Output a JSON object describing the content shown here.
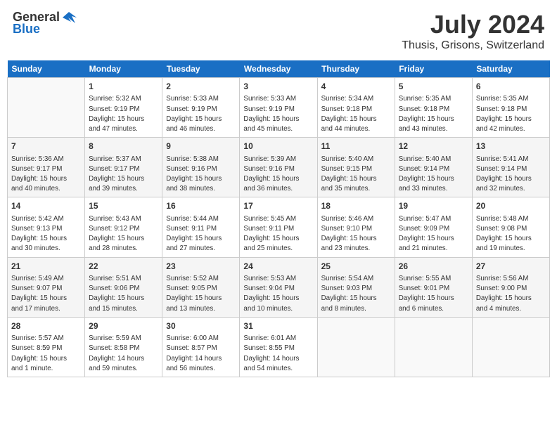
{
  "header": {
    "logo_general": "General",
    "logo_blue": "Blue",
    "month_year": "July 2024",
    "location": "Thusis, Grisons, Switzerland"
  },
  "columns": [
    "Sunday",
    "Monday",
    "Tuesday",
    "Wednesday",
    "Thursday",
    "Friday",
    "Saturday"
  ],
  "weeks": [
    [
      {
        "day": "",
        "content": ""
      },
      {
        "day": "1",
        "content": "Sunrise: 5:32 AM\nSunset: 9:19 PM\nDaylight: 15 hours\nand 47 minutes."
      },
      {
        "day": "2",
        "content": "Sunrise: 5:33 AM\nSunset: 9:19 PM\nDaylight: 15 hours\nand 46 minutes."
      },
      {
        "day": "3",
        "content": "Sunrise: 5:33 AM\nSunset: 9:19 PM\nDaylight: 15 hours\nand 45 minutes."
      },
      {
        "day": "4",
        "content": "Sunrise: 5:34 AM\nSunset: 9:18 PM\nDaylight: 15 hours\nand 44 minutes."
      },
      {
        "day": "5",
        "content": "Sunrise: 5:35 AM\nSunset: 9:18 PM\nDaylight: 15 hours\nand 43 minutes."
      },
      {
        "day": "6",
        "content": "Sunrise: 5:35 AM\nSunset: 9:18 PM\nDaylight: 15 hours\nand 42 minutes."
      }
    ],
    [
      {
        "day": "7",
        "content": "Sunrise: 5:36 AM\nSunset: 9:17 PM\nDaylight: 15 hours\nand 40 minutes."
      },
      {
        "day": "8",
        "content": "Sunrise: 5:37 AM\nSunset: 9:17 PM\nDaylight: 15 hours\nand 39 minutes."
      },
      {
        "day": "9",
        "content": "Sunrise: 5:38 AM\nSunset: 9:16 PM\nDaylight: 15 hours\nand 38 minutes."
      },
      {
        "day": "10",
        "content": "Sunrise: 5:39 AM\nSunset: 9:16 PM\nDaylight: 15 hours\nand 36 minutes."
      },
      {
        "day": "11",
        "content": "Sunrise: 5:40 AM\nSunset: 9:15 PM\nDaylight: 15 hours\nand 35 minutes."
      },
      {
        "day": "12",
        "content": "Sunrise: 5:40 AM\nSunset: 9:14 PM\nDaylight: 15 hours\nand 33 minutes."
      },
      {
        "day": "13",
        "content": "Sunrise: 5:41 AM\nSunset: 9:14 PM\nDaylight: 15 hours\nand 32 minutes."
      }
    ],
    [
      {
        "day": "14",
        "content": "Sunrise: 5:42 AM\nSunset: 9:13 PM\nDaylight: 15 hours\nand 30 minutes."
      },
      {
        "day": "15",
        "content": "Sunrise: 5:43 AM\nSunset: 9:12 PM\nDaylight: 15 hours\nand 28 minutes."
      },
      {
        "day": "16",
        "content": "Sunrise: 5:44 AM\nSunset: 9:11 PM\nDaylight: 15 hours\nand 27 minutes."
      },
      {
        "day": "17",
        "content": "Sunrise: 5:45 AM\nSunset: 9:11 PM\nDaylight: 15 hours\nand 25 minutes."
      },
      {
        "day": "18",
        "content": "Sunrise: 5:46 AM\nSunset: 9:10 PM\nDaylight: 15 hours\nand 23 minutes."
      },
      {
        "day": "19",
        "content": "Sunrise: 5:47 AM\nSunset: 9:09 PM\nDaylight: 15 hours\nand 21 minutes."
      },
      {
        "day": "20",
        "content": "Sunrise: 5:48 AM\nSunset: 9:08 PM\nDaylight: 15 hours\nand 19 minutes."
      }
    ],
    [
      {
        "day": "21",
        "content": "Sunrise: 5:49 AM\nSunset: 9:07 PM\nDaylight: 15 hours\nand 17 minutes."
      },
      {
        "day": "22",
        "content": "Sunrise: 5:51 AM\nSunset: 9:06 PM\nDaylight: 15 hours\nand 15 minutes."
      },
      {
        "day": "23",
        "content": "Sunrise: 5:52 AM\nSunset: 9:05 PM\nDaylight: 15 hours\nand 13 minutes."
      },
      {
        "day": "24",
        "content": "Sunrise: 5:53 AM\nSunset: 9:04 PM\nDaylight: 15 hours\nand 10 minutes."
      },
      {
        "day": "25",
        "content": "Sunrise: 5:54 AM\nSunset: 9:03 PM\nDaylight: 15 hours\nand 8 minutes."
      },
      {
        "day": "26",
        "content": "Sunrise: 5:55 AM\nSunset: 9:01 PM\nDaylight: 15 hours\nand 6 minutes."
      },
      {
        "day": "27",
        "content": "Sunrise: 5:56 AM\nSunset: 9:00 PM\nDaylight: 15 hours\nand 4 minutes."
      }
    ],
    [
      {
        "day": "28",
        "content": "Sunrise: 5:57 AM\nSunset: 8:59 PM\nDaylight: 15 hours\nand 1 minute."
      },
      {
        "day": "29",
        "content": "Sunrise: 5:59 AM\nSunset: 8:58 PM\nDaylight: 14 hours\nand 59 minutes."
      },
      {
        "day": "30",
        "content": "Sunrise: 6:00 AM\nSunset: 8:57 PM\nDaylight: 14 hours\nand 56 minutes."
      },
      {
        "day": "31",
        "content": "Sunrise: 6:01 AM\nSunset: 8:55 PM\nDaylight: 14 hours\nand 54 minutes."
      },
      {
        "day": "",
        "content": ""
      },
      {
        "day": "",
        "content": ""
      },
      {
        "day": "",
        "content": ""
      }
    ]
  ]
}
